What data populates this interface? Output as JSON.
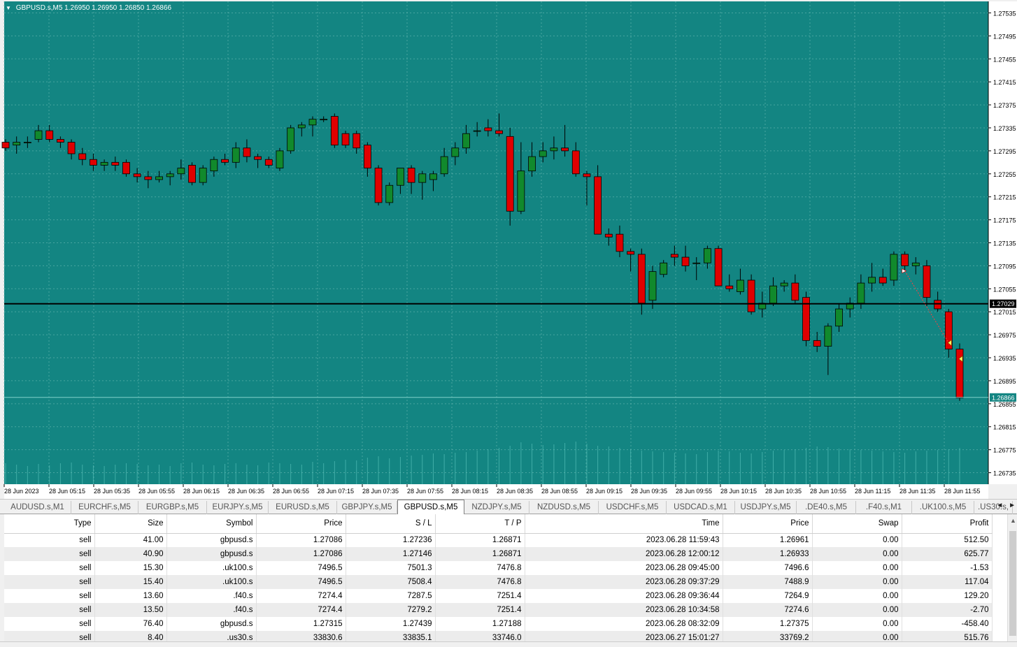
{
  "chart": {
    "symbol_label": "GBPUSD.s,M5",
    "ohlc_text": "1.26950 1.26950 1.26850 1.26866",
    "bg_color": "#138582",
    "bull_color": "#11892c",
    "bear_color": "#e00000",
    "current_price_label": "1.26866",
    "line_price_label": "1.27029",
    "price_ticks": [
      "1.27535",
      "1.27495",
      "1.27455",
      "1.27415",
      "1.27375",
      "1.27335",
      "1.27295",
      "1.27255",
      "1.27215",
      "1.27175",
      "1.27135",
      "1.27095",
      "1.27055",
      "1.27015",
      "1.26975",
      "1.26935",
      "1.26895",
      "1.26855",
      "1.26815",
      "1.26775",
      "1.26735"
    ],
    "time_ticks": [
      "28 Jun 2023",
      "28 Jun 05:15",
      "28 Jun 05:35",
      "28 Jun 05:55",
      "28 Jun 06:15",
      "28 Jun 06:35",
      "28 Jun 06:55",
      "28 Jun 07:15",
      "28 Jun 07:35",
      "28 Jun 07:55",
      "28 Jun 08:15",
      "28 Jun 08:35",
      "28 Jun 08:55",
      "28 Jun 09:15",
      "28 Jun 09:35",
      "28 Jun 09:55",
      "28 Jun 10:15",
      "28 Jun 10:35",
      "28 Jun 10:55",
      "28 Jun 11:15",
      "28 Jun 11:35",
      "28 Jun 11:55"
    ]
  },
  "chart_data": {
    "type": "candlestick",
    "ylim": [
      1.26715,
      1.27555
    ],
    "hline": 1.27029,
    "candles": [
      [
        1.2731,
        1.27315,
        1.27295,
        1.273
      ],
      [
        1.27305,
        1.2732,
        1.2729,
        1.2731
      ],
      [
        1.2731,
        1.2732,
        1.273,
        1.2731
      ],
      [
        1.27315,
        1.2734,
        1.2731,
        1.2733
      ],
      [
        1.2733,
        1.2734,
        1.2731,
        1.27315
      ],
      [
        1.27315,
        1.2732,
        1.273,
        1.2731
      ],
      [
        1.2731,
        1.27315,
        1.2728,
        1.2729
      ],
      [
        1.2729,
        1.273,
        1.2727,
        1.2728
      ],
      [
        1.2728,
        1.2729,
        1.2726,
        1.2727
      ],
      [
        1.2727,
        1.2728,
        1.2726,
        1.27275
      ],
      [
        1.27275,
        1.27285,
        1.2726,
        1.2727
      ],
      [
        1.27275,
        1.2728,
        1.2725,
        1.27255
      ],
      [
        1.27255,
        1.27265,
        1.2724,
        1.2725
      ],
      [
        1.2725,
        1.2726,
        1.2723,
        1.27245
      ],
      [
        1.27245,
        1.2726,
        1.2724,
        1.2725
      ],
      [
        1.2725,
        1.2726,
        1.27235,
        1.27255
      ],
      [
        1.27255,
        1.2728,
        1.27245,
        1.27265
      ],
      [
        1.2727,
        1.27275,
        1.27235,
        1.2724
      ],
      [
        1.2724,
        1.2727,
        1.27235,
        1.27265
      ],
      [
        1.2726,
        1.27285,
        1.2725,
        1.2728
      ],
      [
        1.2728,
        1.2729,
        1.2727,
        1.27275
      ],
      [
        1.27275,
        1.2731,
        1.27265,
        1.273
      ],
      [
        1.273,
        1.27315,
        1.27275,
        1.27285
      ],
      [
        1.27285,
        1.2729,
        1.27265,
        1.2728
      ],
      [
        1.2728,
        1.27285,
        1.27265,
        1.2727
      ],
      [
        1.27265,
        1.273,
        1.2726,
        1.27295
      ],
      [
        1.27295,
        1.2734,
        1.2729,
        1.27335
      ],
      [
        1.27335,
        1.27345,
        1.2732,
        1.2734
      ],
      [
        1.2734,
        1.27355,
        1.2732,
        1.2735
      ],
      [
        1.2735,
        1.27355,
        1.27345,
        1.2735
      ],
      [
        1.27355,
        1.2736,
        1.273,
        1.27305
      ],
      [
        1.27325,
        1.2733,
        1.273,
        1.27305
      ],
      [
        1.27325,
        1.2733,
        1.2729,
        1.273
      ],
      [
        1.27305,
        1.2731,
        1.2725,
        1.27265
      ],
      [
        1.27265,
        1.2727,
        1.272,
        1.27205
      ],
      [
        1.27205,
        1.2724,
        1.272,
        1.27235
      ],
      [
        1.27235,
        1.27265,
        1.2722,
        1.27265
      ],
      [
        1.27265,
        1.2727,
        1.2722,
        1.2724
      ],
      [
        1.2724,
        1.2726,
        1.2721,
        1.27255
      ],
      [
        1.27245,
        1.2726,
        1.27225,
        1.27255
      ],
      [
        1.27255,
        1.273,
        1.2725,
        1.27285
      ],
      [
        1.27285,
        1.2731,
        1.2727,
        1.273
      ],
      [
        1.273,
        1.2734,
        1.2729,
        1.27325
      ],
      [
        1.2733,
        1.27345,
        1.2732,
        1.2733
      ],
      [
        1.27335,
        1.2735,
        1.2732,
        1.2733
      ],
      [
        1.2733,
        1.2736,
        1.2732,
        1.27325
      ],
      [
        1.2732,
        1.27335,
        1.27165,
        1.2719
      ],
      [
        1.2719,
        1.2731,
        1.27185,
        1.2726
      ],
      [
        1.2726,
        1.2731,
        1.2725,
        1.27285
      ],
      [
        1.27285,
        1.2731,
        1.27275,
        1.27295
      ],
      [
        1.27295,
        1.2732,
        1.2728,
        1.273
      ],
      [
        1.273,
        1.2734,
        1.27285,
        1.27295
      ],
      [
        1.27295,
        1.2731,
        1.2725,
        1.27255
      ],
      [
        1.27255,
        1.2726,
        1.272,
        1.2725
      ],
      [
        1.2725,
        1.2727,
        1.2715,
        1.2715
      ],
      [
        1.2715,
        1.2716,
        1.2713,
        1.27145
      ],
      [
        1.2715,
        1.27165,
        1.2711,
        1.2712
      ],
      [
        1.2712,
        1.27125,
        1.27085,
        1.27115
      ],
      [
        1.27115,
        1.27125,
        1.2701,
        1.2703
      ],
      [
        1.27035,
        1.27095,
        1.2702,
        1.27085
      ],
      [
        1.2708,
        1.27105,
        1.27075,
        1.271
      ],
      [
        1.27115,
        1.2713,
        1.27095,
        1.2711
      ],
      [
        1.2711,
        1.2713,
        1.27085,
        1.27095
      ],
      [
        1.271,
        1.2711,
        1.2707,
        1.271
      ],
      [
        1.271,
        1.2713,
        1.2709,
        1.27125
      ],
      [
        1.27125,
        1.2713,
        1.2706,
        1.2706
      ],
      [
        1.2706,
        1.2708,
        1.2705,
        1.27055
      ],
      [
        1.2705,
        1.2709,
        1.27045,
        1.2707
      ],
      [
        1.2707,
        1.2708,
        1.2701,
        1.27015
      ],
      [
        1.2702,
        1.2705,
        1.27005,
        1.2703
      ],
      [
        1.2703,
        1.27075,
        1.27025,
        1.2706
      ],
      [
        1.2706,
        1.2707,
        1.2705,
        1.27065
      ],
      [
        1.27065,
        1.2708,
        1.2703,
        1.27035
      ],
      [
        1.2704,
        1.2705,
        1.26955,
        1.26965
      ],
      [
        1.26965,
        1.2698,
        1.26945,
        1.26955
      ],
      [
        1.26955,
        1.26995,
        1.26905,
        1.2699
      ],
      [
        1.2699,
        1.2703,
        1.2698,
        1.2702
      ],
      [
        1.2702,
        1.2704,
        1.27005,
        1.2703
      ],
      [
        1.2703,
        1.2708,
        1.2702,
        1.27065
      ],
      [
        1.27065,
        1.271,
        1.2705,
        1.27075
      ],
      [
        1.27075,
        1.2709,
        1.2706,
        1.27065
      ],
      [
        1.2707,
        1.2712,
        1.2706,
        1.27115
      ],
      [
        1.27115,
        1.2712,
        1.27085,
        1.27095
      ],
      [
        1.27095,
        1.2711,
        1.2708,
        1.271
      ],
      [
        1.27095,
        1.27105,
        1.27025,
        1.2704
      ],
      [
        1.27035,
        1.2705,
        1.27015,
        1.2702
      ],
      [
        1.27015,
        1.2702,
        1.26935,
        1.2695
      ],
      [
        1.2695,
        1.2696,
        1.2686,
        1.26865
      ]
    ],
    "volumes": [
      30,
      28,
      26,
      29,
      27,
      30,
      31,
      28,
      27,
      26,
      28,
      30,
      29,
      27,
      28,
      26,
      30,
      31,
      28,
      27,
      29,
      30,
      28,
      27,
      31,
      30,
      29,
      28,
      32,
      30,
      33,
      35,
      34,
      38,
      40,
      37,
      39,
      41,
      42,
      44,
      43,
      45,
      46,
      48,
      50,
      52,
      55,
      60,
      58,
      56,
      57,
      59,
      61,
      58,
      55,
      54,
      52,
      50,
      48,
      47,
      46,
      45,
      44,
      43,
      46,
      48,
      47,
      45,
      44,
      46,
      48,
      49,
      50,
      52,
      54,
      53,
      51,
      50,
      49,
      48,
      47,
      46,
      45,
      47,
      48,
      49,
      50,
      52
    ]
  },
  "tabs": [
    {
      "label": "AUDUSD.s,M1"
    },
    {
      "label": "EURCHF.s,M5"
    },
    {
      "label": "EURGBP.s,M5"
    },
    {
      "label": "EURJPY.s,M5"
    },
    {
      "label": "EURUSD.s,M5"
    },
    {
      "label": "GBPJPY.s,M5"
    },
    {
      "label": "GBPUSD.s,M5"
    },
    {
      "label": "NZDJPY.s,M5"
    },
    {
      "label": "NZDUSD.s,M5"
    },
    {
      "label": "USDCHF.s,M5"
    },
    {
      "label": "USDCAD.s,M1"
    },
    {
      "label": "USDJPY.s,M5"
    },
    {
      "label": ".DE40.s,M5"
    },
    {
      "label": ".F40.s,M1"
    },
    {
      "label": ".UK100.s,M5"
    },
    {
      "label": ".US30.s,"
    }
  ],
  "tab_nav": {
    "prev": "◄",
    "next": "►"
  },
  "trades": {
    "headers": [
      "Type",
      "Size",
      "Symbol",
      "Price",
      "S / L",
      "T / P",
      "Time",
      "Price",
      "Swap",
      "Profit"
    ],
    "rows": [
      [
        "sell",
        "41.00",
        "gbpusd.s",
        "1.27086",
        "1.27236",
        "1.26871",
        "2023.06.28 11:59:43",
        "1.26961",
        "0.00",
        "512.50"
      ],
      [
        "sell",
        "40.90",
        "gbpusd.s",
        "1.27086",
        "1.27146",
        "1.26871",
        "2023.06.28 12:00:12",
        "1.26933",
        "0.00",
        "625.77"
      ],
      [
        "sell",
        "15.30",
        ".uk100.s",
        "7496.5",
        "7501.3",
        "7476.8",
        "2023.06.28 09:45:00",
        "7496.6",
        "0.00",
        "-1.53"
      ],
      [
        "sell",
        "15.40",
        ".uk100.s",
        "7496.5",
        "7508.4",
        "7476.8",
        "2023.06.28 09:37:29",
        "7488.9",
        "0.00",
        "117.04"
      ],
      [
        "sell",
        "13.60",
        ".f40.s",
        "7274.4",
        "7287.5",
        "7251.4",
        "2023.06.28 09:36:44",
        "7264.9",
        "0.00",
        "129.20"
      ],
      [
        "sell",
        "13.50",
        ".f40.s",
        "7274.4",
        "7279.2",
        "7251.4",
        "2023.06.28 10:34:58",
        "7274.6",
        "0.00",
        "-2.70"
      ],
      [
        "sell",
        "76.40",
        "gbpusd.s",
        "1.27315",
        "1.27439",
        "1.27188",
        "2023.06.28 08:32:09",
        "1.27375",
        "0.00",
        "-458.40"
      ],
      [
        "sell",
        "8.40",
        ".us30.s",
        "33830.6",
        "33835.1",
        "33746.0",
        "2023.06.27 15:01:27",
        "33769.2",
        "0.00",
        "515.76"
      ]
    ]
  }
}
